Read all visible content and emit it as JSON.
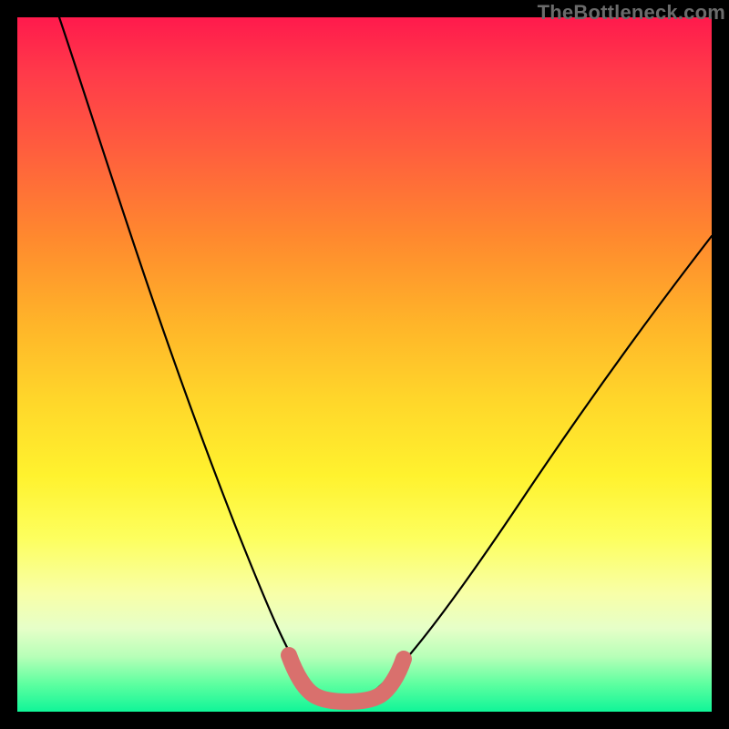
{
  "watermark": "TheBottleneck.com",
  "chart_data": {
    "type": "line",
    "title": "",
    "xlabel": "",
    "ylabel": "",
    "x_range": [
      0,
      100
    ],
    "y_range": [
      0,
      100
    ],
    "series": [
      {
        "name": "bottleneck-curve",
        "color": "#000000",
        "x": [
          6,
          10,
          14,
          18,
          22,
          26,
          30,
          34,
          38,
          40,
          42,
          44,
          46,
          48,
          50,
          52,
          56,
          60,
          64,
          68,
          72,
          76,
          80,
          84,
          88,
          92,
          96,
          100
        ],
        "y": [
          100,
          92,
          84,
          76,
          67,
          58,
          49,
          40,
          30,
          24,
          18,
          11,
          6,
          2.5,
          2.2,
          2.4,
          5,
          11,
          18,
          25,
          32,
          39,
          46,
          52,
          58,
          63,
          67,
          71
        ]
      },
      {
        "name": "optimal-range-marker",
        "color": "#d9706d",
        "x": [
          40,
          41,
          42,
          43,
          44,
          45,
          46,
          47,
          48,
          49,
          50,
          51,
          52,
          53,
          54
        ],
        "y": [
          24,
          21,
          18,
          14,
          10,
          7,
          5,
          3.2,
          2.5,
          2.3,
          2.2,
          2.3,
          2.5,
          3.3,
          5
        ]
      }
    ],
    "gradient_stops": [
      {
        "pos": 0.0,
        "color": "#ff1a4c"
      },
      {
        "pos": 0.5,
        "color": "#ffe62e"
      },
      {
        "pos": 1.0,
        "color": "#10f598"
      }
    ]
  }
}
